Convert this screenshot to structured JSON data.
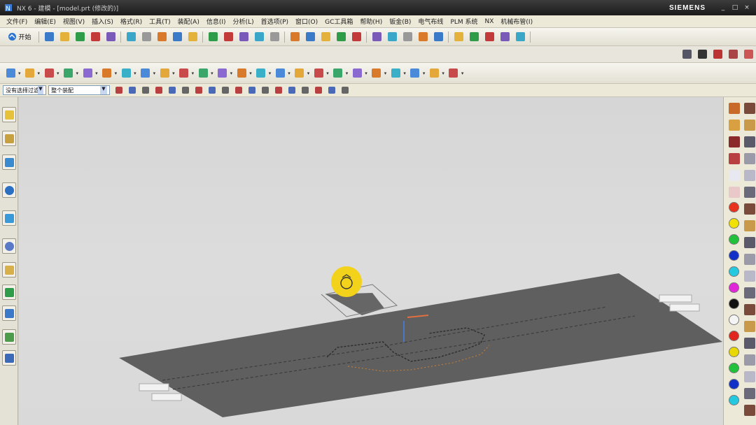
{
  "window": {
    "title": "NX 6 - 建模 - [model.prt (修改的)]",
    "brand": "SIEMENS",
    "controls": [
      "_",
      "□",
      "×"
    ]
  },
  "menu": [
    "文件(F)",
    "编辑(E)",
    "视图(V)",
    "插入(S)",
    "格式(R)",
    "工具(T)",
    "装配(A)",
    "信息(I)",
    "分析(L)",
    "首选项(P)",
    "窗口(O)",
    "GC工具箱",
    "帮助(H)",
    "钣金(B)",
    "电气布线",
    "PLM 系统",
    "NX",
    "机械布管(I)"
  ],
  "toolbar1": {
    "start_label": "开始",
    "icons": [
      "new-icon",
      "open-icon",
      "save-icon",
      "cut-icon",
      "copy-icon",
      "paste-icon",
      "undo-icon",
      "redo-icon",
      "window-icon",
      "display-icon",
      "sketch-icon",
      "extrude-icon",
      "revolve-icon",
      "orient-icon",
      "fit-icon",
      "zoom-icon",
      "pan-icon",
      "rotate-icon",
      "shaded-icon",
      "wireframe-icon",
      "refresh-icon",
      "render-icon",
      "section-icon",
      "layer-icon",
      "measure-icon",
      "analysis-icon",
      "assembly-icon",
      "reuse-icon",
      "roles-icon",
      "history-icon"
    ]
  },
  "toolbar3_icons": [
    "sheet-icon",
    "tab-icon",
    "flange-icon",
    "contour-flange-icon",
    "lofted-flange-icon",
    "hem-icon",
    "bend-icon",
    "unbend-icon",
    "rebend-icon",
    "joggle-icon",
    "bead-icon",
    "louver-icon",
    "dimple-icon",
    "drawn-cutout-icon",
    "gusset-icon",
    "corner-icon",
    "closed-corner-icon",
    "relief-icon",
    "normal-cutout-icon",
    "flat-solid-icon",
    "flat-pattern-icon",
    "convert-icon",
    "rip-icon",
    "cleanup-icon"
  ],
  "selection_bar": {
    "filter_value": "没有选择过滤器",
    "scope_value": "整个装配"
  },
  "palette": {
    "colors": [
      "#e8321e",
      "#f0e100",
      "#22c13c",
      "#1030c8",
      "#24c9e0",
      "#e026d8",
      "#111111",
      "#f4f4f4",
      "#e0261e",
      "#e8d800",
      "#22c13c",
      "#1030c8",
      "#24c9e0"
    ]
  },
  "viewport": {
    "background": "#d8d8d8",
    "part_color": "#5f5f5f",
    "cursor_icon": "rotate-cursor-icon"
  }
}
